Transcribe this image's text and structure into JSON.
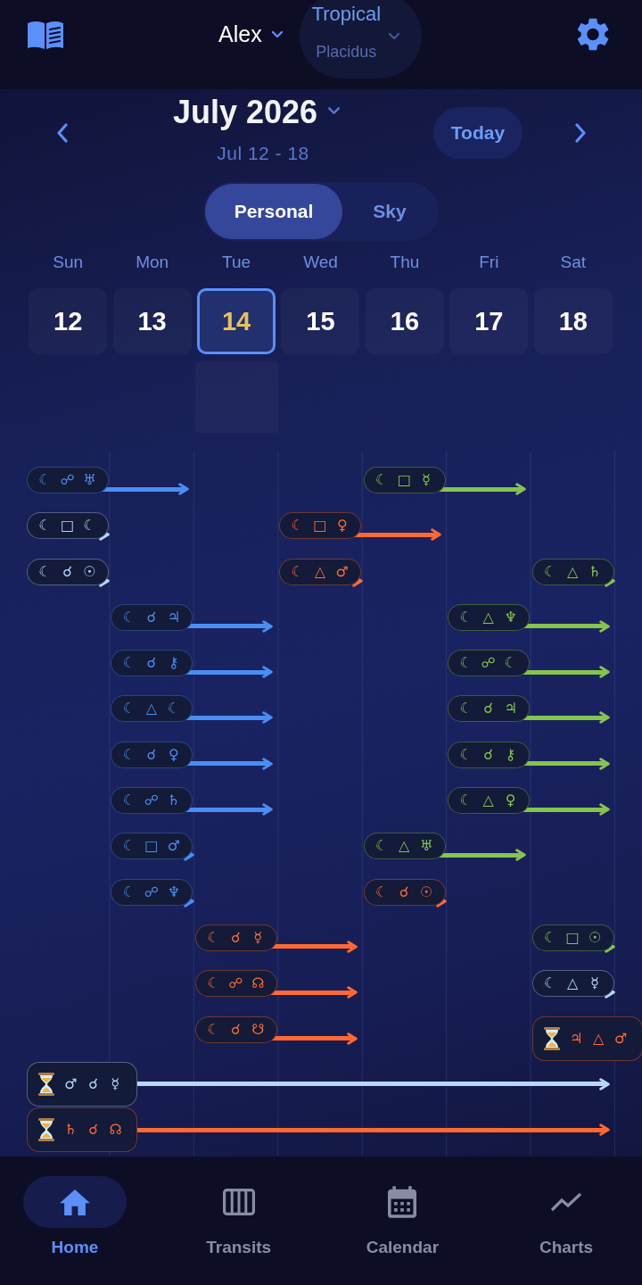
{
  "top_bar": {
    "profile": {
      "name": "Alex"
    },
    "zodiac": {
      "system": "Tropical",
      "houses": "Placidus"
    }
  },
  "week_header": {
    "month": "July 2026",
    "range": "Jul 12 - 18",
    "today_button": "Today"
  },
  "view_tabs": [
    {
      "label": "Personal",
      "selected": true
    },
    {
      "label": "Sky",
      "selected": false
    }
  ],
  "days": [
    {
      "weekday": "Sun",
      "date": "12",
      "selected": false
    },
    {
      "weekday": "Mon",
      "date": "13",
      "selected": false
    },
    {
      "weekday": "Tue",
      "date": "14",
      "selected": true
    },
    {
      "weekday": "Wed",
      "date": "15",
      "selected": false
    },
    {
      "weekday": "Thu",
      "date": "16",
      "selected": false
    },
    {
      "weekday": "Fri",
      "date": "17",
      "selected": false
    },
    {
      "weekday": "Sat",
      "date": "18",
      "selected": false
    }
  ],
  "transits": {
    "lanes": [
      {
        "slots": [
          {
            "kind": "pill",
            "color": "#4a8ef5",
            "glyphs": [
              "☾",
              "☍",
              "♅"
            ]
          },
          {
            "kind": "run"
          },
          {
            "kind": "empty"
          },
          {
            "kind": "empty"
          },
          {
            "kind": "pill",
            "color": "#86c44e",
            "glyphs": [
              "☾",
              "□",
              "☿"
            ]
          },
          {
            "kind": "run"
          }
        ]
      },
      {
        "slots": [
          {
            "kind": "pill",
            "color": "#b8d6ff",
            "glyphs": [
              "☾",
              "□",
              "☾"
            ]
          },
          {
            "kind": "empty"
          },
          {
            "kind": "empty"
          },
          {
            "kind": "pill",
            "color": "#ff6a33",
            "glyphs": [
              "☾",
              "□",
              "♀"
            ]
          },
          {
            "kind": "run"
          }
        ]
      },
      {
        "slots": [
          {
            "kind": "pill",
            "color": "#b8d6ff",
            "glyphs": [
              "☾",
              "☌",
              "☉"
            ]
          },
          {
            "kind": "empty"
          },
          {
            "kind": "empty"
          },
          {
            "kind": "pill",
            "color": "#ff6a33",
            "glyphs": [
              "☾",
              "△",
              "♂"
            ]
          },
          {
            "kind": "empty"
          },
          {
            "kind": "empty"
          },
          {
            "kind": "pill",
            "color": "#86c44e",
            "glyphs": [
              "☾",
              "△",
              "♄"
            ]
          }
        ]
      },
      {
        "slots": [
          {
            "kind": "empty"
          },
          {
            "kind": "pill",
            "color": "#4a8ef5",
            "glyphs": [
              "☾",
              "☌",
              "♃"
            ]
          },
          {
            "kind": "run"
          },
          {
            "kind": "empty"
          },
          {
            "kind": "empty"
          },
          {
            "kind": "pill",
            "color": "#86c44e",
            "glyphs": [
              "☾",
              "△",
              "♆"
            ]
          },
          {
            "kind": "run"
          }
        ]
      },
      {
        "slots": [
          {
            "kind": "empty"
          },
          {
            "kind": "pill",
            "color": "#4a8ef5",
            "glyphs": [
              "☾",
              "☌",
              "⚷"
            ]
          },
          {
            "kind": "run"
          },
          {
            "kind": "empty"
          },
          {
            "kind": "empty"
          },
          {
            "kind": "pill",
            "color": "#86c44e",
            "glyphs": [
              "☾",
              "☍",
              "☾"
            ]
          },
          {
            "kind": "run"
          }
        ]
      },
      {
        "slots": [
          {
            "kind": "empty"
          },
          {
            "kind": "pill",
            "color": "#4a8ef5",
            "glyphs": [
              "☾",
              "△",
              "☾"
            ]
          },
          {
            "kind": "run"
          },
          {
            "kind": "empty"
          },
          {
            "kind": "empty"
          },
          {
            "kind": "pill",
            "color": "#86c44e",
            "glyphs": [
              "☾",
              "☌",
              "♃"
            ]
          },
          {
            "kind": "run"
          }
        ]
      },
      {
        "slots": [
          {
            "kind": "empty"
          },
          {
            "kind": "pill",
            "color": "#4a8ef5",
            "glyphs": [
              "☾",
              "☌",
              "♀"
            ]
          },
          {
            "kind": "run"
          },
          {
            "kind": "empty"
          },
          {
            "kind": "empty"
          },
          {
            "kind": "pill",
            "color": "#86c44e",
            "glyphs": [
              "☾",
              "☌",
              "⚷"
            ]
          },
          {
            "kind": "run"
          }
        ]
      },
      {
        "slots": [
          {
            "kind": "empty"
          },
          {
            "kind": "pill",
            "color": "#4a8ef5",
            "glyphs": [
              "☾",
              "☍",
              "♄"
            ]
          },
          {
            "kind": "run"
          },
          {
            "kind": "empty"
          },
          {
            "kind": "empty"
          },
          {
            "kind": "pill",
            "color": "#86c44e",
            "glyphs": [
              "☾",
              "△",
              "♀"
            ]
          },
          {
            "kind": "run"
          }
        ]
      },
      {
        "slots": [
          {
            "kind": "empty"
          },
          {
            "kind": "pill",
            "color": "#4a8ef5",
            "glyphs": [
              "☾",
              "□",
              "♂"
            ]
          },
          {
            "kind": "empty"
          },
          {
            "kind": "empty"
          },
          {
            "kind": "pill",
            "color": "#86c44e",
            "glyphs": [
              "☾",
              "△",
              "♅"
            ]
          },
          {
            "kind": "run"
          }
        ]
      },
      {
        "slots": [
          {
            "kind": "empty"
          },
          {
            "kind": "pill",
            "color": "#4a8ef5",
            "glyphs": [
              "☾",
              "☍",
              "♆"
            ]
          },
          {
            "kind": "empty"
          },
          {
            "kind": "empty"
          },
          {
            "kind": "pill",
            "color": "#ff6a33",
            "glyphs": [
              "☾",
              "☌",
              "☉"
            ]
          }
        ]
      },
      {
        "slots": [
          {
            "kind": "empty"
          },
          {
            "kind": "empty"
          },
          {
            "kind": "pill",
            "color": "#ff6a33",
            "glyphs": [
              "☾",
              "☌",
              "☿"
            ]
          },
          {
            "kind": "run"
          },
          {
            "kind": "empty"
          },
          {
            "kind": "empty"
          },
          {
            "kind": "pill",
            "color": "#86c44e",
            "glyphs": [
              "☾",
              "□",
              "☉"
            ]
          }
        ]
      },
      {
        "slots": [
          {
            "kind": "empty"
          },
          {
            "kind": "empty"
          },
          {
            "kind": "pill",
            "color": "#ff6a33",
            "glyphs": [
              "☾",
              "☍",
              "☊"
            ]
          },
          {
            "kind": "run"
          },
          {
            "kind": "empty"
          },
          {
            "kind": "empty"
          },
          {
            "kind": "pill",
            "color": "#b8d6ff",
            "glyphs": [
              "☾",
              "△",
              "☿"
            ]
          }
        ]
      },
      {
        "slots": [
          {
            "kind": "empty"
          },
          {
            "kind": "empty"
          },
          {
            "kind": "pill",
            "color": "#ff6a33",
            "glyphs": [
              "☾",
              "☌",
              "☋"
            ]
          },
          {
            "kind": "run"
          },
          {
            "kind": "empty"
          },
          {
            "kind": "empty"
          },
          {
            "kind": "slow",
            "color": "#ff6a33",
            "glyphs": [
              "♃",
              "△",
              "♂"
            ]
          }
        ]
      },
      {
        "slots": [
          {
            "kind": "slow",
            "color": "#b8d6ff",
            "glyphs": [
              "♂",
              "☌",
              "☿"
            ]
          },
          {
            "kind": "run"
          },
          {
            "kind": "run"
          },
          {
            "kind": "run"
          },
          {
            "kind": "run"
          },
          {
            "kind": "run"
          },
          {
            "kind": "run"
          }
        ]
      },
      {
        "slots": [
          {
            "kind": "slow",
            "color": "#ff6a33",
            "glyphs": [
              "♄",
              "☌",
              "☊"
            ]
          },
          {
            "kind": "run"
          },
          {
            "kind": "run"
          },
          {
            "kind": "run"
          },
          {
            "kind": "run"
          },
          {
            "kind": "run"
          },
          {
            "kind": "run"
          }
        ]
      }
    ]
  },
  "bottom_nav": [
    {
      "label": "Home",
      "selected": true
    },
    {
      "label": "Transits",
      "selected": false
    },
    {
      "label": "Calendar",
      "selected": false
    },
    {
      "label": "Charts",
      "selected": false
    }
  ]
}
